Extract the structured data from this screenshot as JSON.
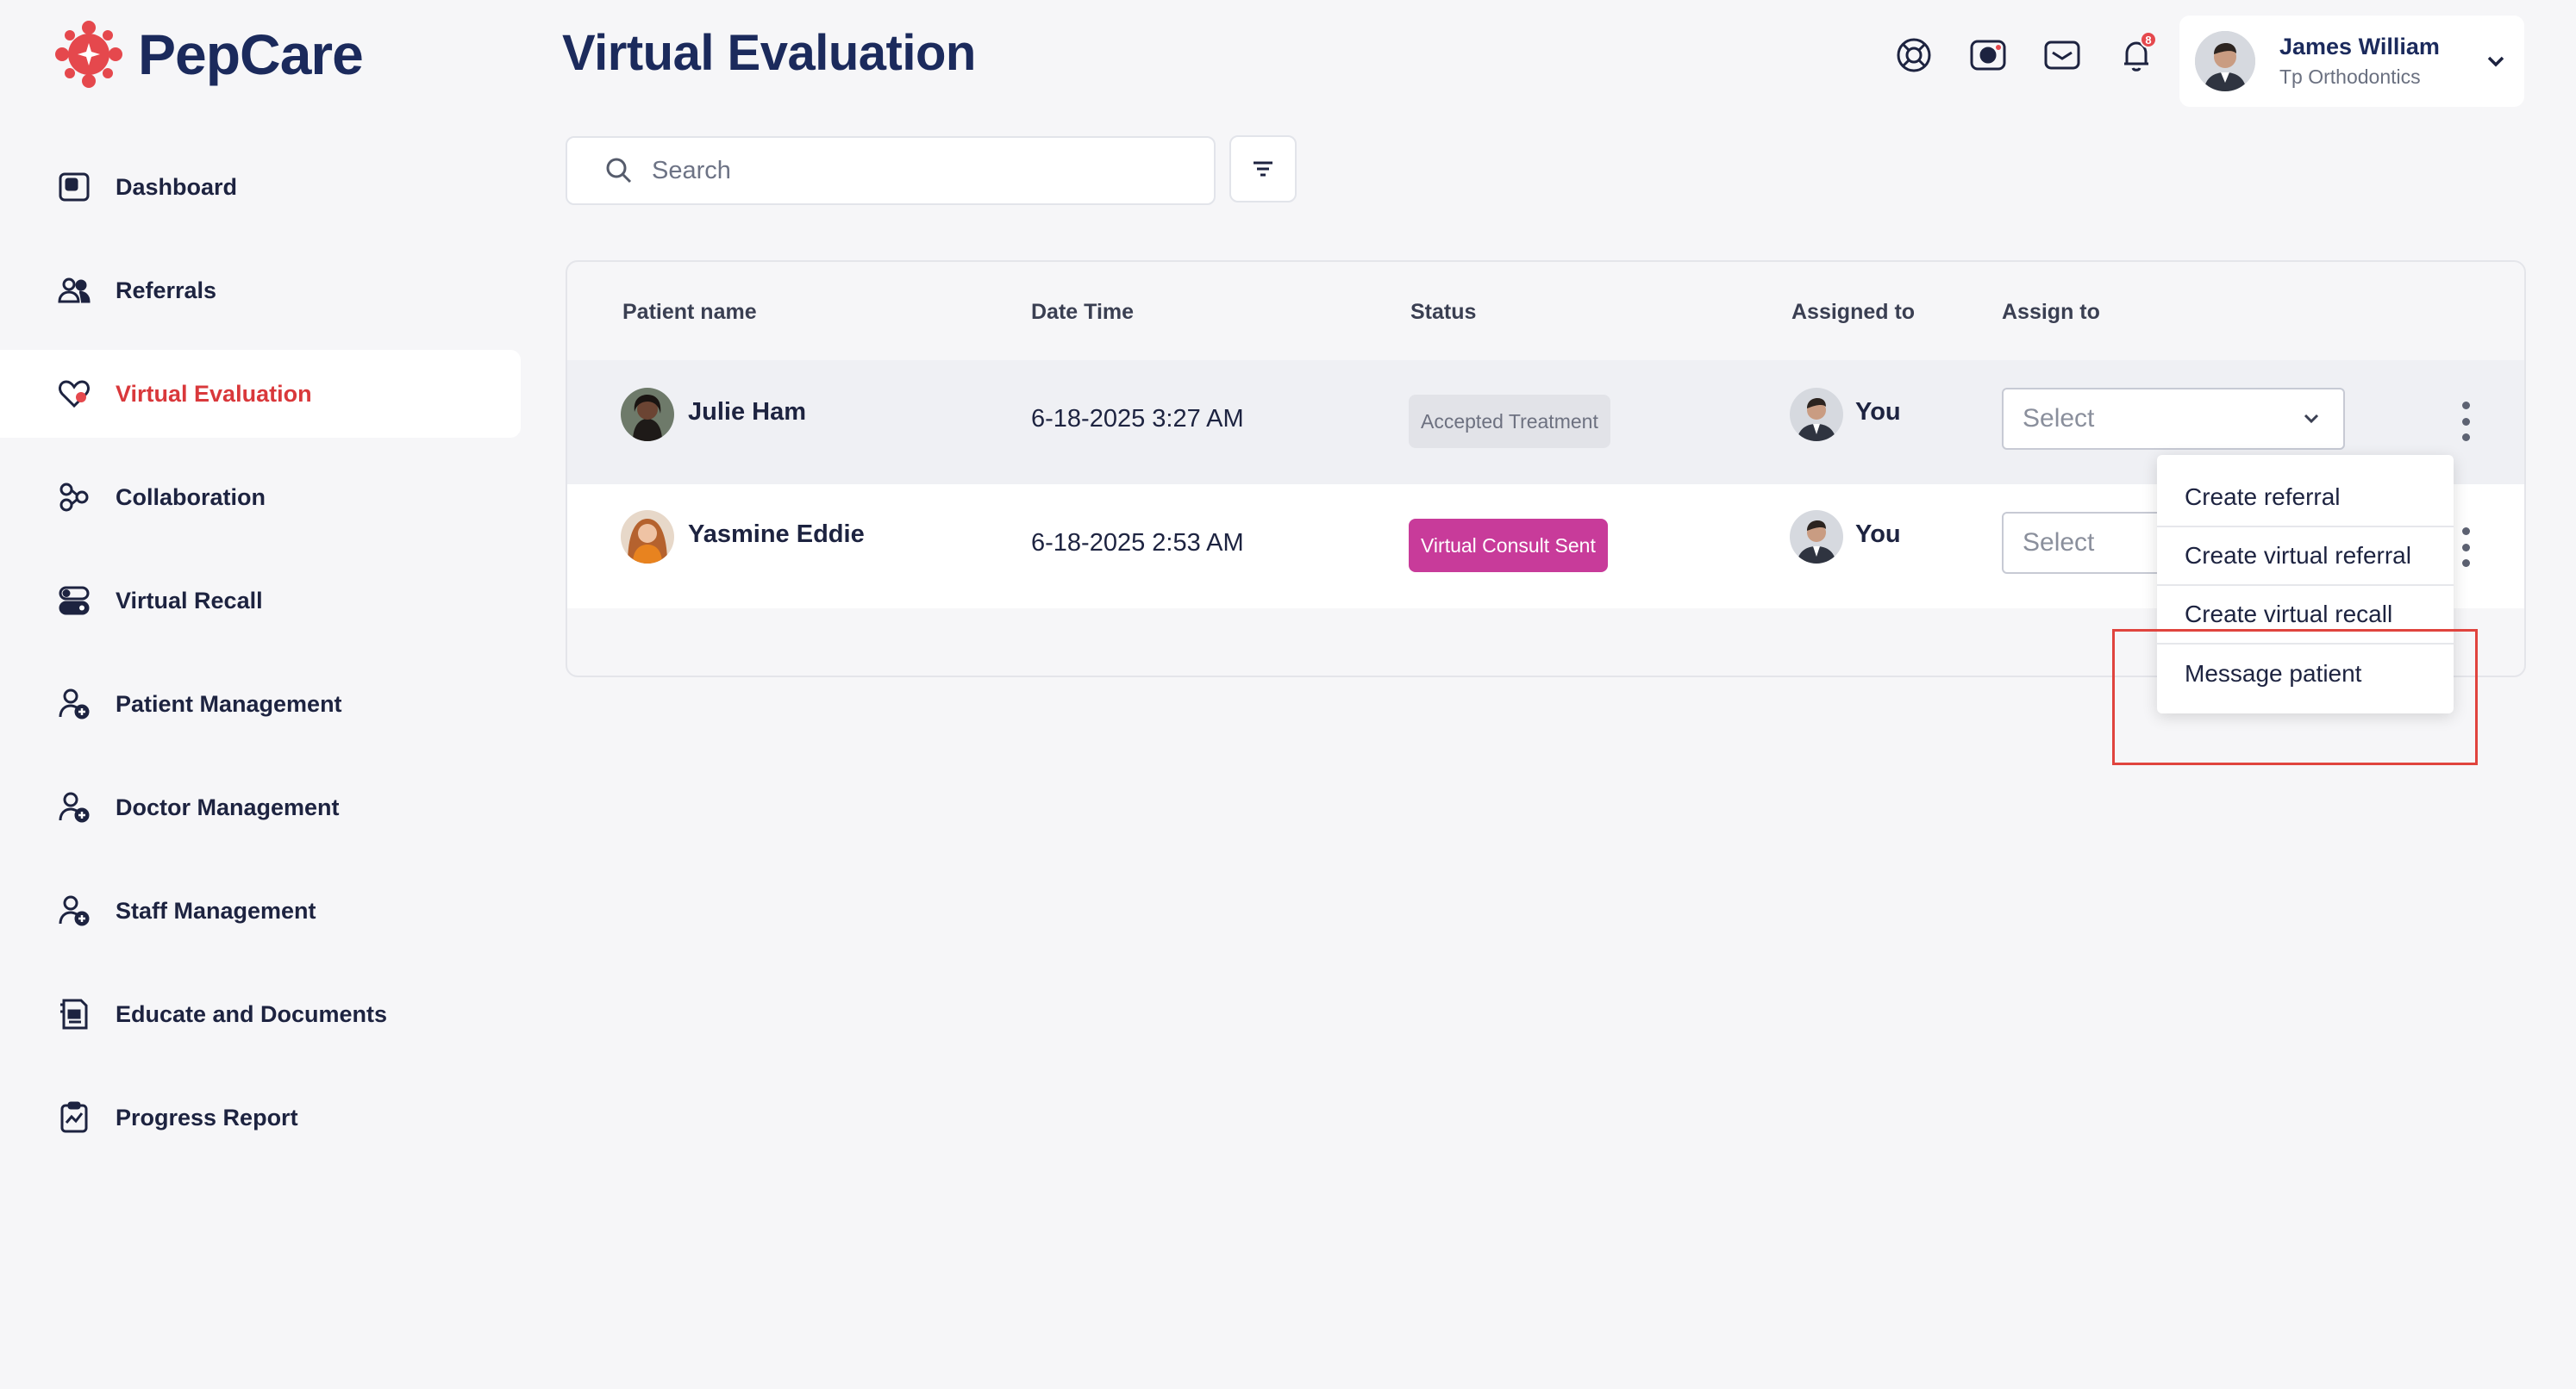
{
  "app": {
    "brand_name": "PepCare",
    "brand_color": "#e5484d"
  },
  "sidebar": {
    "items": [
      {
        "label": "Dashboard",
        "icon": "dashboard-icon",
        "active": false
      },
      {
        "label": "Referrals",
        "icon": "users-icon",
        "active": false
      },
      {
        "label": "Virtual Evaluation",
        "icon": "heart-icon",
        "active": true
      },
      {
        "label": "Collaboration",
        "icon": "collaboration-icon",
        "active": false
      },
      {
        "label": "Virtual Recall",
        "icon": "toggle-icon",
        "active": false
      },
      {
        "label": "Patient Management",
        "icon": "user-plus-icon",
        "active": false
      },
      {
        "label": "Doctor Management",
        "icon": "user-plus-icon",
        "active": false
      },
      {
        "label": "Staff Management",
        "icon": "user-plus-icon",
        "active": false
      },
      {
        "label": "Educate and Documents",
        "icon": "document-icon",
        "active": false
      },
      {
        "label": "Progress Report",
        "icon": "clipboard-chart-icon",
        "active": false
      }
    ]
  },
  "header": {
    "title": "Virtual Evaluation",
    "icons": [
      "support-icon",
      "camera-icon",
      "mail-icon",
      "bell-icon"
    ],
    "notification_count": "8",
    "user": {
      "name": "James William",
      "org": "Tp Orthodontics"
    }
  },
  "search": {
    "placeholder": "Search"
  },
  "table": {
    "columns": [
      "Patient name",
      "Date Time",
      "Status",
      "Assigned to",
      "Assign to"
    ],
    "rows": [
      {
        "patient": "Julie Ham",
        "datetime": "6-18-2025 3:27 AM",
        "status": "Accepted Treatment",
        "assigned": "You",
        "assign_placeholder": "Select"
      },
      {
        "patient": "Yasmine Eddie",
        "datetime": "6-18-2025 2:53 AM",
        "status": "Virtual Consult Sent",
        "assigned": "You",
        "assign_placeholder": "Select"
      }
    ]
  },
  "row_menu": {
    "items": [
      "Create referral",
      "Create virtual referral",
      "Create virtual recall",
      "Message patient"
    ]
  },
  "colors": {
    "accent": "#d9383b",
    "status_consult": "#c83b9a",
    "status_accepted": "#e2e3e8"
  }
}
